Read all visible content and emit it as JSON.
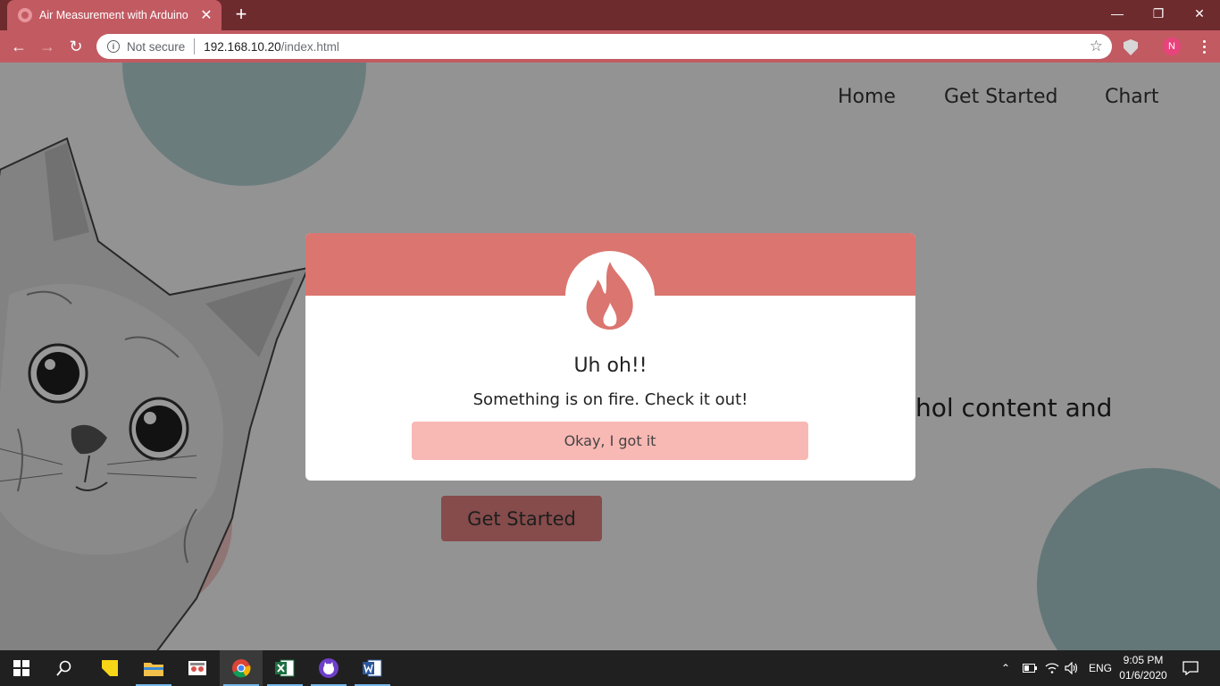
{
  "browser": {
    "tab_title": "Air Measurement with Arduino",
    "tab_close": "✕",
    "new_tab": "+",
    "omnibox": {
      "security_label": "Not secure",
      "url_host": "192.168.10.20",
      "url_path": "/index.html"
    },
    "profile_initial": "N",
    "window_controls": [
      "—",
      "❐",
      "✕"
    ]
  },
  "site": {
    "nav": [
      "Home",
      "Get Started",
      "Chart"
    ],
    "hero_text_visible": "hol content and",
    "hero_button": "Get Started"
  },
  "modal": {
    "title": "Uh oh!!",
    "message": "Something is on fire. Check it out!",
    "button": "Okay, I got it",
    "icon": "fire-icon",
    "header_color": "#db756f",
    "button_color": "#f8b8b4"
  },
  "taskbar": {
    "apps": [
      "start-icon",
      "search-icon",
      "sticky-notes-icon",
      "file-explorer-icon",
      "snipping-tool-icon",
      "chrome-icon",
      "excel-icon",
      "github-desktop-icon",
      "word-icon"
    ],
    "tray_language": "ENG",
    "clock_time": "9:05 PM",
    "clock_date": "01/6/2020"
  }
}
